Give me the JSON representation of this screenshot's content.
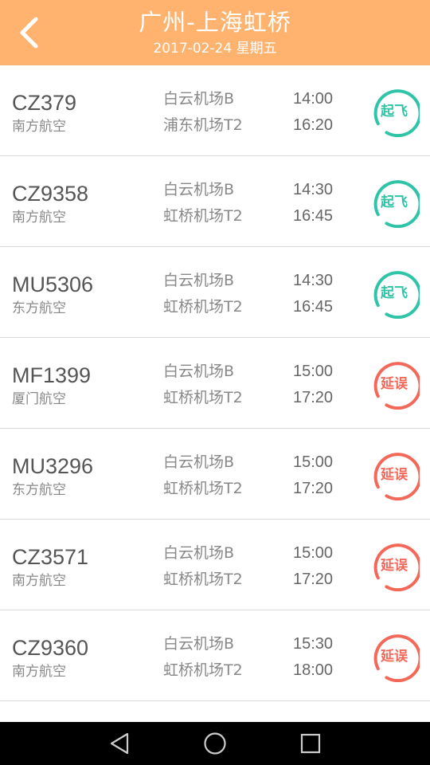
{
  "header": {
    "title": "广州-上海虹桥",
    "subtitle": "2017-02-24 星期五",
    "back_icon": "chevron-left-icon"
  },
  "colors": {
    "header_bg": "#ffb36e",
    "departed": "#2fc4a8",
    "delayed": "#f4685a"
  },
  "flights": [
    {
      "no": "CZ379",
      "airline": "南方航空",
      "dep_airport": "白云机场B",
      "arr_airport": "浦东机场T2",
      "dep_time": "14:00",
      "arr_time": "16:20",
      "status": "起飞",
      "status_type": "departed"
    },
    {
      "no": "CZ9358",
      "airline": "南方航空",
      "dep_airport": "白云机场B",
      "arr_airport": "虹桥机场T2",
      "dep_time": "14:30",
      "arr_time": "16:45",
      "status": "起飞",
      "status_type": "departed"
    },
    {
      "no": "MU5306",
      "airline": "东方航空",
      "dep_airport": "白云机场B",
      "arr_airport": "虹桥机场T2",
      "dep_time": "14:30",
      "arr_time": "16:45",
      "status": "起飞",
      "status_type": "departed"
    },
    {
      "no": "MF1399",
      "airline": "厦门航空",
      "dep_airport": "白云机场B",
      "arr_airport": "虹桥机场T2",
      "dep_time": "15:00",
      "arr_time": "17:20",
      "status": "延误",
      "status_type": "delayed"
    },
    {
      "no": "MU3296",
      "airline": "东方航空",
      "dep_airport": "白云机场B",
      "arr_airport": "虹桥机场T2",
      "dep_time": "15:00",
      "arr_time": "17:20",
      "status": "延误",
      "status_type": "delayed"
    },
    {
      "no": "CZ3571",
      "airline": "南方航空",
      "dep_airport": "白云机场B",
      "arr_airport": "虹桥机场T2",
      "dep_time": "15:00",
      "arr_time": "17:20",
      "status": "延误",
      "status_type": "delayed"
    },
    {
      "no": "CZ9360",
      "airline": "南方航空",
      "dep_airport": "白云机场B",
      "arr_airport": "虹桥机场T2",
      "dep_time": "15:30",
      "arr_time": "18:00",
      "status": "延误",
      "status_type": "delayed"
    }
  ],
  "navbar": {
    "back_icon": "triangle-back-icon",
    "home_icon": "circle-home-icon",
    "recent_icon": "square-recent-apps-icon"
  }
}
